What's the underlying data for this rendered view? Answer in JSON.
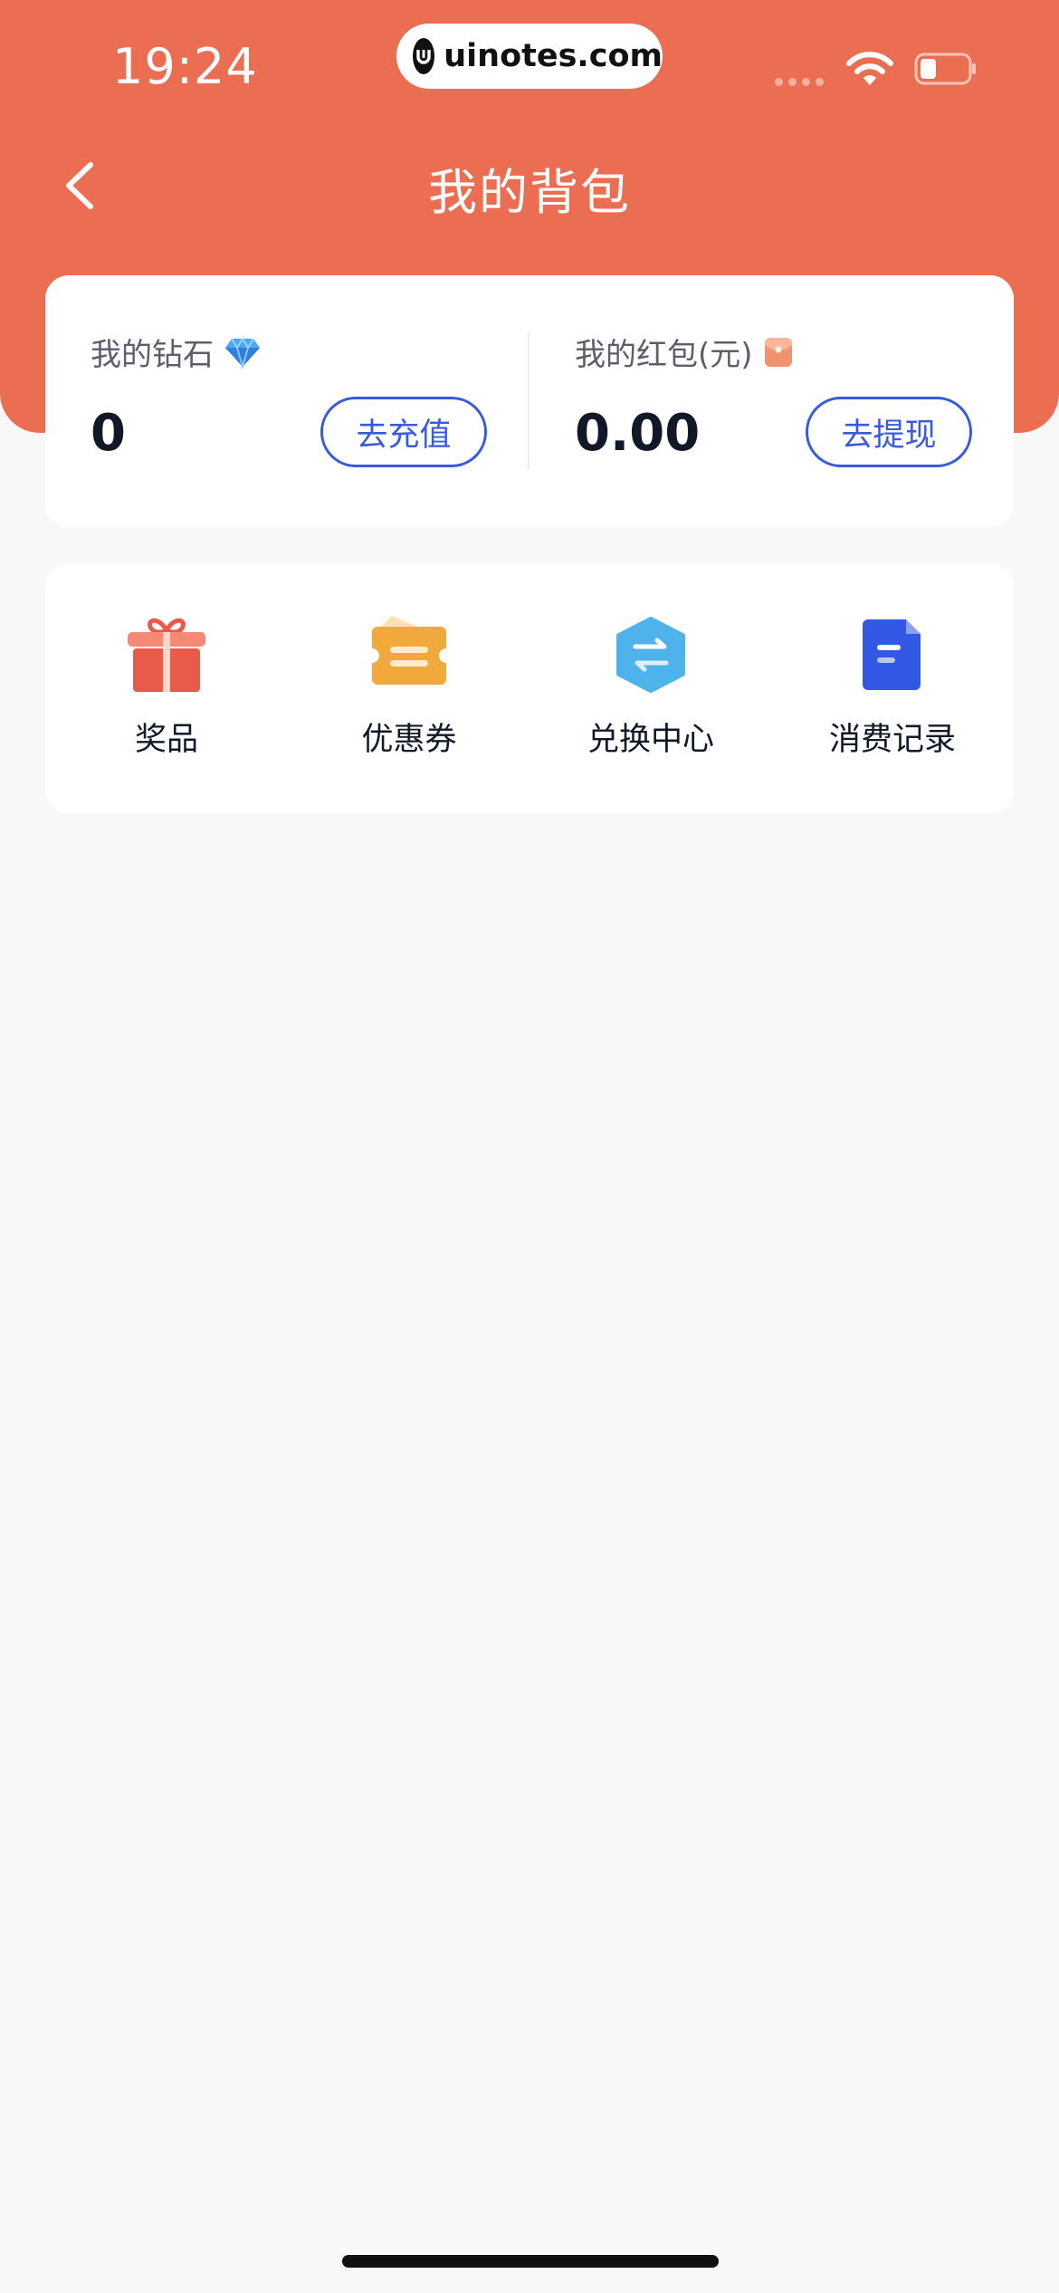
{
  "status_bar": {
    "time": "19:24",
    "url": "uinotes.com"
  },
  "nav": {
    "title": "我的背包",
    "back_icon": "chevron-left-icon"
  },
  "wallet": {
    "diamonds": {
      "label": "我的钻石",
      "icon": "diamond-icon",
      "value": "0",
      "button": "去充值"
    },
    "red_packet": {
      "label": "我的红包(元)",
      "icon": "red-packet-icon",
      "value": "0.00",
      "button": "去提现"
    }
  },
  "menu": {
    "items": [
      {
        "label": "奖品",
        "icon": "gift-icon",
        "color": "#e85a4a"
      },
      {
        "label": "优惠券",
        "icon": "coupon-icon",
        "color": "#f2a93b"
      },
      {
        "label": "兑换中心",
        "icon": "exchange-icon",
        "color": "#4db3ea"
      },
      {
        "label": "消费记录",
        "icon": "record-document-icon",
        "color": "#3458e6"
      }
    ]
  },
  "colors": {
    "header": "#eb6e52",
    "accent": "#3a5bd9",
    "background": "#f8f8f8"
  }
}
